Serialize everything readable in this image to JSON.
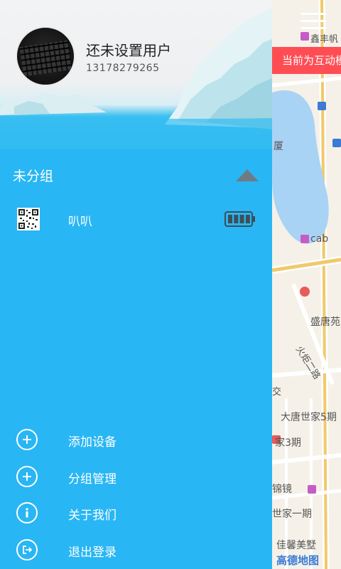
{
  "profile": {
    "name": "还未设置用户",
    "phone": "13178279265"
  },
  "group": {
    "title": "未分组",
    "devices": [
      {
        "name": "叭叭",
        "battery_level": 1.0
      }
    ]
  },
  "menu": [
    {
      "label": "添加设备",
      "icon": "add-circle-icon"
    },
    {
      "label": "分组管理",
      "icon": "add-circle-icon"
    },
    {
      "label": "关于我们",
      "icon": "info-circle-icon"
    },
    {
      "label": "退出登录",
      "icon": "logout-icon"
    }
  ],
  "map": {
    "banner": "当前为互动模式",
    "labels": [
      "鑫丰帆",
      "厦",
      "cab",
      "盛唐苑",
      "火炬二路",
      "交",
      "大唐世家5期",
      "家3期",
      "锦镜",
      "世家一期",
      "佳馨美墅"
    ],
    "provider": "高德地图"
  },
  "colors": {
    "drawer": "#29b6f4",
    "banner": "#ff4d54",
    "water": "#a9d3f5"
  }
}
